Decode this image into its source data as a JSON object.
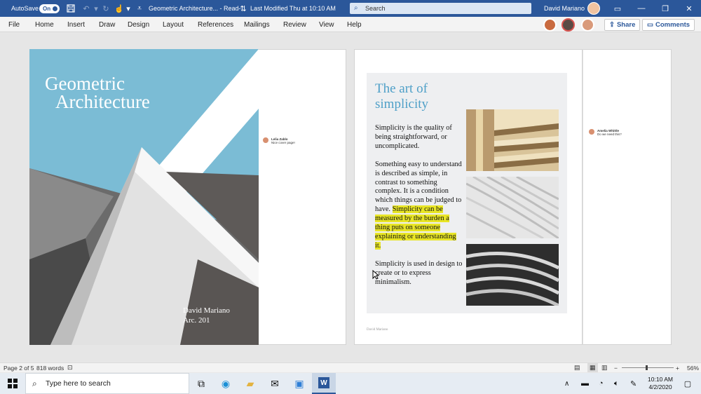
{
  "titlebar": {
    "autosave_label": "AutoSave",
    "autosave_state": "On",
    "document_title": "Geometric Architecture... - Read-...",
    "modified": "Last Modified Thu at 10:10 AM",
    "search_placeholder": "Search",
    "user_name": "David Mariano",
    "accent": "#2b579a"
  },
  "menu": {
    "items": [
      "File",
      "Home",
      "Insert",
      "Draw",
      "Design",
      "Layout",
      "References",
      "Mailings",
      "Review",
      "View",
      "Help"
    ],
    "share_label": "Share",
    "comments_label": "Comments"
  },
  "cover": {
    "title_line1": "Geometric",
    "title_line2": "Architecture",
    "author": "David Mariano",
    "course": "Arc. 201",
    "sky_color": "#7bbcd5"
  },
  "comments": [
    {
      "author": "Lelia Zablo",
      "text": "Nice cover page!"
    },
    {
      "author": "Amelia Whittle",
      "text": "Do we need this?"
    }
  ],
  "page2": {
    "title_line1": "The art of",
    "title_line2": "simplicity",
    "para1": "Simplicity is the quality of being straightforward, or uncomplicated.",
    "para2_plain": "Something easy to understand is described as simple, in contrast to something complex. It is a condition which things can be judged to have.",
    "para2_highlight": "Simplicity can be measured by the burden a thing puts on someone explaining or understanding it.",
    "para3": "Simplicity is used in design to create or to express minimalism.",
    "footer": "David Mariano",
    "title_color": "#4fa0c8",
    "highlight_color": "#e8e526"
  },
  "status": {
    "page": "Page 2 of 5",
    "words": "818 words",
    "zoom": "56%"
  },
  "taskbar": {
    "search_placeholder": "Type here to search",
    "time": "10:10 AM",
    "date": "4/2/2020"
  }
}
